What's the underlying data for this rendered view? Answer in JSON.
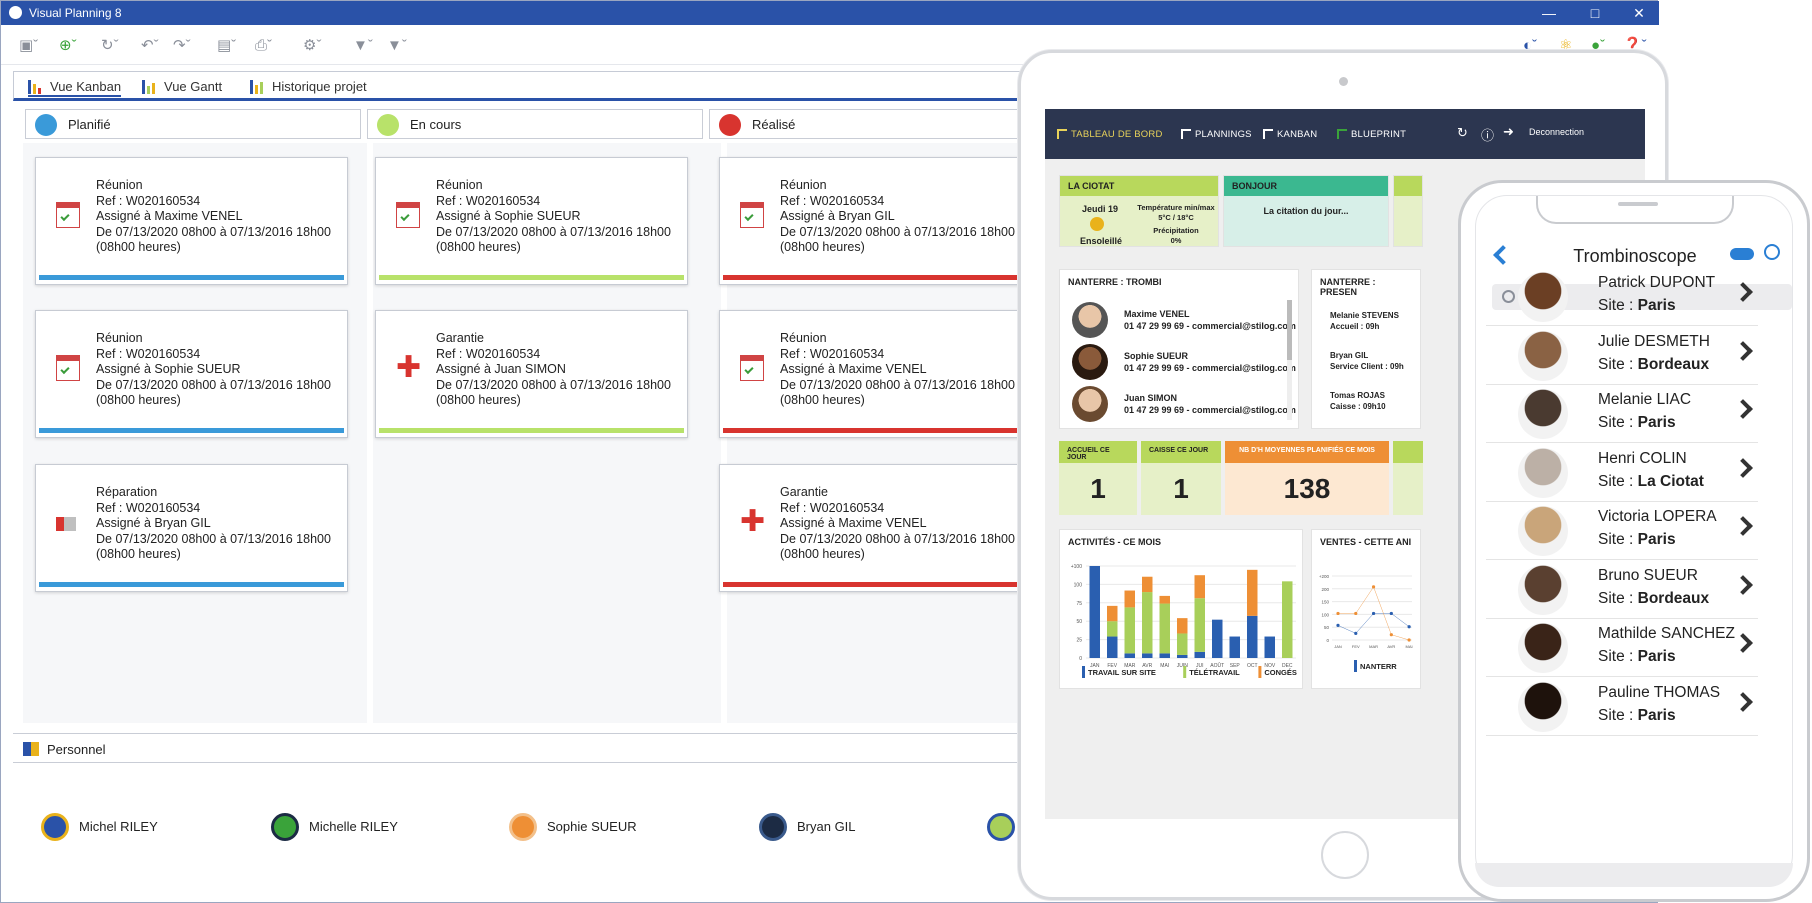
{
  "window": {
    "title": "Visual Planning 8"
  },
  "tabs": [
    {
      "label": "Vue Kanban"
    },
    {
      "label": "Vue Gantt"
    },
    {
      "label": "Historique projet"
    }
  ],
  "columns": [
    {
      "label": "Planifié",
      "color": "#3a9ad9"
    },
    {
      "label": "En cours",
      "color": "#b8e26a"
    },
    {
      "label": "Réalisé",
      "color": "#d8342f"
    }
  ],
  "cards": [
    {
      "text": "Réunion\nRef : W020160534\nAssigné à Maxime VENEL\nDe 07/13/2020 08h00 à 07/13/2016 18h00\n(08h00 heures)",
      "icon": "calendar-icon"
    },
    {
      "text": "Réunion\nRef : W020160534\nAssigné à Sophie SUEUR\nDe 07/13/2020 08h00 à 07/13/2016 18h00\n(08h00 heures)",
      "icon": "calendar-icon"
    },
    {
      "text": "Réparation\nRef : W020160534\nAssigné à Bryan GIL\nDe 07/13/2020 08h00 à 07/13/2016 18h00\n(08h00 heures)",
      "icon": "megaphone-icon"
    },
    {
      "text": "Réunion\nRef : W020160534\nAssigné à Sophie SUEUR\nDe 07/13/2020 08h00 à 07/13/2016 18h00\n(08h00 heures)",
      "icon": "calendar-icon"
    },
    {
      "text": "Garantie\nRef : W020160534\nAssigné à Juan SIMON\nDe 07/13/2020 08h00 à 07/13/2016 18h00\n(08h00 heures)",
      "icon": "cross-icon"
    },
    {
      "text": "Réunion\nRef : W020160534\nAssigné à Bryan GIL\nDe 07/13/2020 08h00 à 07/13/2016 18h00\n(08h00 heures)",
      "icon": "calendar-icon"
    },
    {
      "text": "Réunion\nRef : W020160534\nAssigné à Maxime VENEL\nDe 07/13/2020 08h00 à 07/13/2016 18h00\n(08h00 heures)",
      "icon": "calendar-icon"
    },
    {
      "text": "Garantie\nRef : W020160534\nAssigné à Maxime VENEL\nDe 07/13/2020 08h00 à 07/13/2016 18h00\n(08h00 heures)",
      "icon": "cross-icon"
    }
  ],
  "personnel": {
    "label": "Personnel",
    "people": [
      "Michel RILEY",
      "Michelle RILEY",
      "Sophie SUEUR",
      "Bryan GIL"
    ]
  },
  "tablet": {
    "nav": [
      "TABLEAU DE BORD",
      "PLANNINGS",
      "KANBAN",
      "BLUEPRINT"
    ],
    "logout": "Deconnection",
    "weather": {
      "title": "LA CIOTAT",
      "day": "Jeudi 19",
      "cond": "Ensoleillé",
      "temp_label": "Température min/max",
      "temp": "5°C / 18°C",
      "precip_label": "Précipitation",
      "precip": "0%"
    },
    "bonjour": {
      "title": "BONJOUR",
      "quote": "La citation du jour..."
    },
    "trombi": {
      "title": "NANTERRE : TROMBI",
      "people": [
        {
          "name": "Maxime VENEL",
          "info": "01 47 29 99 69 - commercial@stilog.com"
        },
        {
          "name": "Sophie SUEUR",
          "info": "01 47 29 99 69 - commercial@stilog.com"
        },
        {
          "name": "Juan SIMON",
          "info": "01 47 29 99 69 - commercial@stilog.com"
        }
      ]
    },
    "presence": {
      "title": "NANTERRE : PRESEN",
      "people": [
        {
          "name": "Melanie STEVENS",
          "info": "Accueil : 09h"
        },
        {
          "name": "Bryan GIL",
          "info": "Service Client : 09h"
        },
        {
          "name": "Tomas ROJAS",
          "info": "Caisse : 09h10"
        }
      ]
    },
    "stats": [
      {
        "label": "ACCUEIL CE JOUR",
        "value": "1"
      },
      {
        "label": "CAISSE CE JOUR",
        "value": "1"
      },
      {
        "label": "NB D'H MOYENNES PLANIFIÉS CE MOIS",
        "value": "138"
      }
    ],
    "activities_title": "ACTIVITÉS - CE MOIS",
    "ventes_title": "VENTES - CETTE ANI",
    "ventes_legend": "NANTERR"
  },
  "chart_data": [
    {
      "type": "bar",
      "title": "ACTIVITÉS - CE MOIS",
      "categories": [
        "JAN",
        "FEV",
        "MAR",
        "AVR",
        "MAI",
        "JUIN",
        "JUI",
        "AOÛT",
        "SEP",
        "OCT",
        "NOV",
        "DEC"
      ],
      "ylim": [
        0,
        120
      ],
      "yticks": [
        "0",
        "25",
        "50",
        "75",
        "100",
        "+100"
      ],
      "series": [
        {
          "name": "TRAVAIL SUR SITE",
          "color": "#2a5fb0",
          "values": [
            120,
            28,
            6,
            6,
            6,
            4,
            8,
            50,
            28,
            55,
            28,
            0
          ]
        },
        {
          "name": "TÉLÉTRAVAIL",
          "color": "#a8cf5a",
          "values": [
            0,
            20,
            60,
            80,
            65,
            28,
            70,
            0,
            0,
            0,
            0,
            100
          ]
        },
        {
          "name": "CONGÉS",
          "color": "#ee8f35",
          "values": [
            0,
            20,
            22,
            20,
            10,
            20,
            30,
            0,
            0,
            60,
            0,
            0
          ]
        }
      ]
    },
    {
      "type": "line",
      "title": "VENTES - CETTE ANI",
      "categories": [
        "JAN",
        "FEV",
        "MAR",
        "AVR",
        "MAI"
      ],
      "ylim": [
        0,
        200
      ],
      "yticks": [
        "0",
        "50",
        "100",
        "150",
        "200",
        "+200"
      ],
      "series": [
        {
          "name": "NANTERR",
          "color": "#2a5fb0",
          "values": [
            55,
            25,
            100,
            100,
            50
          ]
        },
        {
          "name": "",
          "color": "#ee8f35",
          "values": [
            100,
            100,
            200,
            20,
            0
          ]
        }
      ]
    }
  ],
  "phone": {
    "title": "Trombinoscope",
    "search_placeholder": "",
    "site_prefix": "Site : ",
    "people": [
      {
        "name": "Patrick DUPONT",
        "site": "Paris"
      },
      {
        "name": "Julie DESMETH",
        "site": "Bordeaux"
      },
      {
        "name": "Melanie LIAC",
        "site": "Paris"
      },
      {
        "name": "Henri COLIN",
        "site": "La Ciotat"
      },
      {
        "name": "Victoria LOPERA",
        "site": "Paris"
      },
      {
        "name": "Bruno SUEUR",
        "site": "Bordeaux"
      },
      {
        "name": "Mathilde SANCHEZ",
        "site": "Paris"
      },
      {
        "name": "Pauline THOMAS",
        "site": "Paris"
      }
    ]
  }
}
